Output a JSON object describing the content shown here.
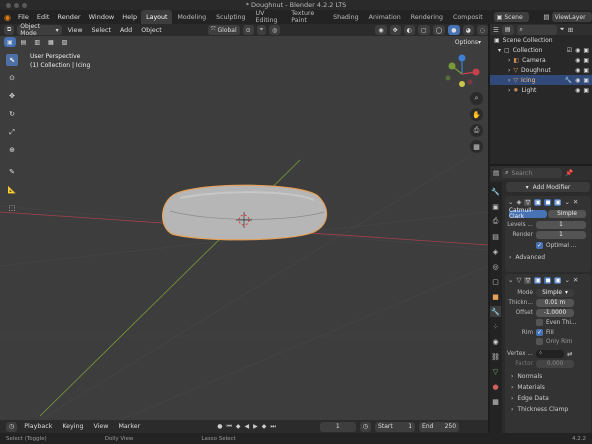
{
  "window": {
    "title": "* Doughnut - Blender 4.2.2 LTS"
  },
  "menubar": {
    "items": [
      "File",
      "Edit",
      "Render",
      "Window",
      "Help"
    ],
    "workspaces": [
      "Layout",
      "Modeling",
      "Sculpting",
      "UV Editing",
      "Texture Paint",
      "Shading",
      "Animation",
      "Rendering",
      "Composit"
    ],
    "scene": "Scene",
    "view_layer": "ViewLayer"
  },
  "header": {
    "mode": "Object Mode",
    "menus": [
      "View",
      "Select",
      "Add",
      "Object"
    ],
    "orientation": "Global",
    "options": "Options"
  },
  "viewport": {
    "perspective": "User Perspective",
    "collection": "(1) Collection | Icing"
  },
  "outliner": {
    "search_placeholder": "",
    "root": "Scene Collection",
    "collection": "Collection",
    "items": [
      {
        "name": "Camera",
        "color": "#c98b55"
      },
      {
        "name": "Doughnut",
        "color": "#e5a05a"
      },
      {
        "name": "Icing",
        "color": "#e5a05a"
      },
      {
        "name": "Light",
        "color": "#c98b55"
      }
    ]
  },
  "properties": {
    "search_placeholder": "Search",
    "add_modifier": "Add Modifier",
    "subsurf": {
      "type_a": "Catmull-Clark",
      "type_b": "Simple",
      "levels_label": "Levels ...",
      "levels_value": "1",
      "render_label": "Render",
      "render_value": "1",
      "optimal": "Optimal ...",
      "advanced": "Advanced"
    },
    "solidify": {
      "mode_label": "Mode",
      "mode_value": "Simple",
      "thickness_label": "Thickn...",
      "thickness_value": "0.01 m",
      "offset_label": "Offset",
      "offset_value": "-1.0000",
      "even": "Even Thi...",
      "rim_label": "Rim",
      "fill": "Fill",
      "only_rim": "Only Rim",
      "vertex_label": "Vertex ...",
      "factor_label": "Factor",
      "factor_value": "0.000",
      "sections": [
        "Normals",
        "Materials",
        "Edge Data",
        "Thickness Clamp"
      ]
    }
  },
  "timeline": {
    "menus": [
      "Playback",
      "Keying",
      "View",
      "Marker"
    ],
    "current_frame": "1",
    "start_label": "Start",
    "start": "1",
    "end_label": "End",
    "end": "250"
  },
  "statusbar": {
    "items": [
      "Select (Toggle)",
      "Dolly View",
      "Lasso Select"
    ],
    "version": "4.2.2"
  },
  "colors": {
    "accent": "#4772b3",
    "selected_outline": "#e5a05a",
    "x_axis": "#a3414b",
    "y_axis": "#7a9a3a"
  }
}
